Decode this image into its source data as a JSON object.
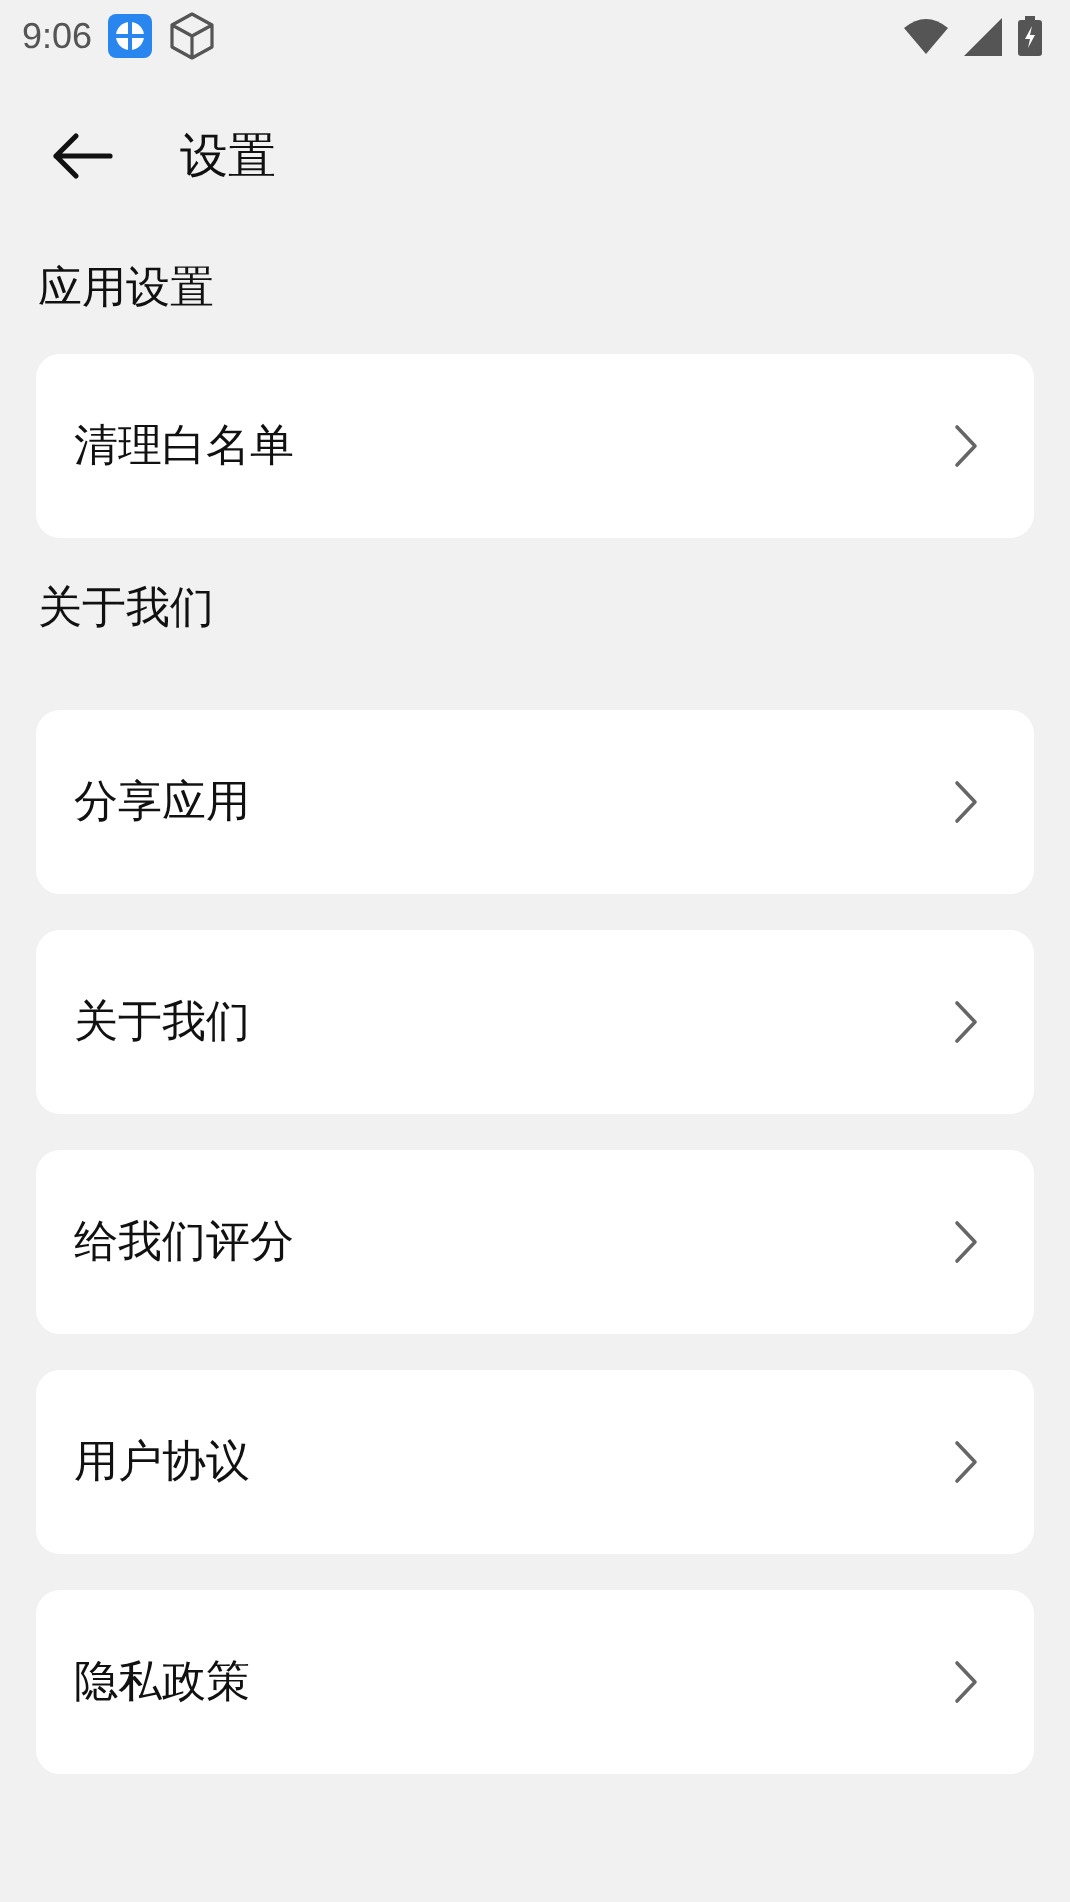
{
  "status_bar": {
    "time": "9:06"
  },
  "header": {
    "title": "设置"
  },
  "sections": [
    {
      "title": "应用设置",
      "items": [
        {
          "label": "清理白名单"
        }
      ]
    },
    {
      "title": "关于我们",
      "items": [
        {
          "label": "分享应用"
        },
        {
          "label": "关于我们"
        },
        {
          "label": "给我们评分"
        },
        {
          "label": "用户协议"
        },
        {
          "label": "隐私政策"
        }
      ]
    }
  ]
}
